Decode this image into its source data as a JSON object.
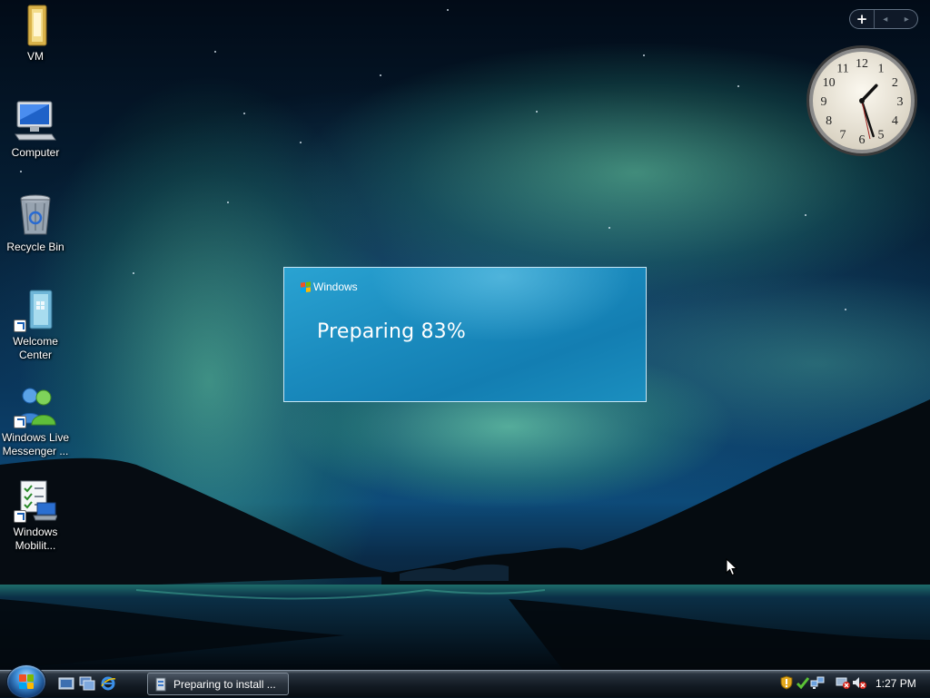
{
  "desktop": {
    "icons": [
      {
        "label": "VM"
      },
      {
        "label": "Computer"
      },
      {
        "label": "Recycle Bin"
      },
      {
        "label": "Welcome\nCenter"
      },
      {
        "label": "Windows Live\nMessenger ..."
      },
      {
        "label": "Windows\nMobilit..."
      }
    ]
  },
  "gadgets": {
    "add_label": "+",
    "prev_label": "◂",
    "next_label": "▸",
    "clock": {
      "hour": 1,
      "minute": 27,
      "second": 28
    }
  },
  "setup": {
    "brand": "Windows",
    "status": "Preparing 83%"
  },
  "taskbar": {
    "task_label": "Preparing to install ...",
    "clock_time": "1:27 PM"
  },
  "icons": {
    "start": "windows-flag-icon",
    "quicklaunch": [
      "show-desktop-icon",
      "switch-windows-icon",
      "internet-explorer-icon"
    ],
    "tray": [
      "security-alert-icon",
      "windows-update-icon",
      "network-icon",
      "network-disconnected-icon",
      "volume-muted-icon"
    ]
  },
  "colors": {
    "setup_bg": "#1b8cbf",
    "flag_red": "#f25022",
    "flag_green": "#7fba00",
    "flag_blue": "#00a4ef",
    "flag_yellow": "#ffb900"
  }
}
